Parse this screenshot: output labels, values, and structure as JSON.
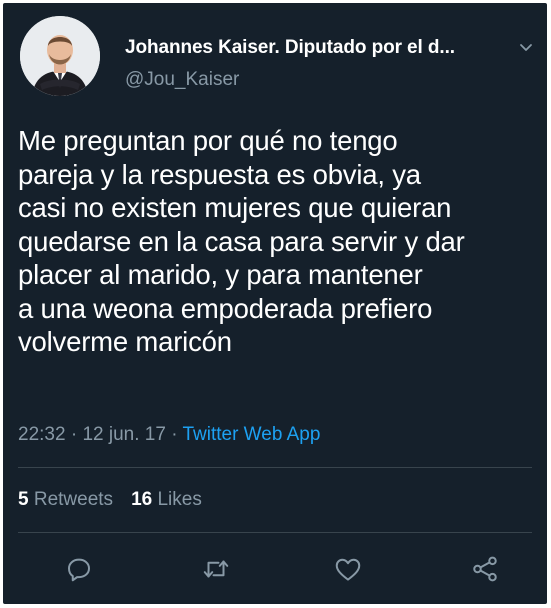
{
  "tweet": {
    "author_name": "Johannes Kaiser. Diputado por el d...",
    "author_handle": "@Jou_Kaiser",
    "text": "Me preguntan por qué no tengo\npareja y la respuesta es obvia, ya\ncasi no existen mujeres que quieran\nquedarse en la casa para servir y dar\nplacer al marido, y para mantener\na una weona empoderada prefiero\nvolverme maricón",
    "time": "22:32",
    "date": "12 jun. 17",
    "source": "Twitter Web App",
    "separator": "·"
  },
  "stats": {
    "retweets_count": "5",
    "retweets_label": "Retweets",
    "likes_count": "16",
    "likes_label": "Likes"
  },
  "icons": {
    "more": "chevron-down-icon",
    "reply": "reply-icon",
    "retweet": "retweet-icon",
    "like": "heart-icon",
    "share": "share-icon"
  },
  "colors": {
    "background": "#15202b",
    "text": "#ffffff",
    "muted": "#8899a6",
    "accent": "#1da1f2",
    "divider": "#38444d"
  }
}
